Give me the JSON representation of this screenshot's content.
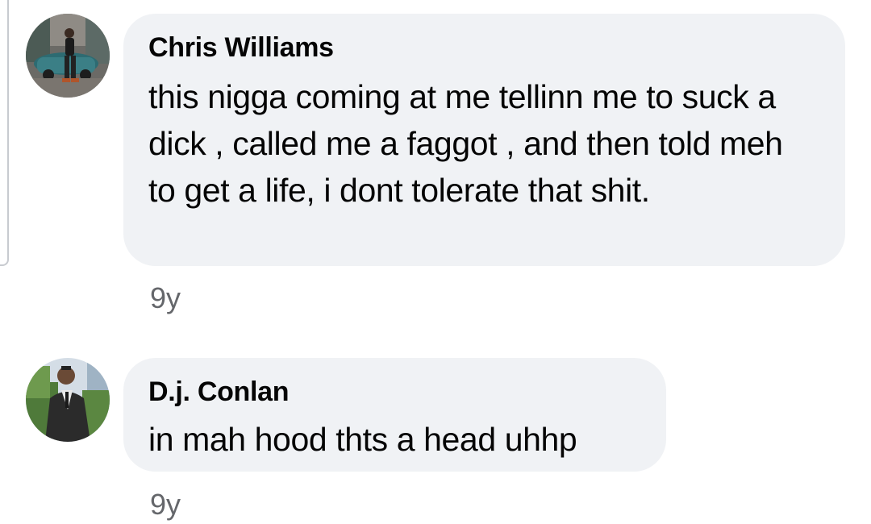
{
  "comments": [
    {
      "author": "Chris Williams",
      "text": "this nigga coming at me tellinn me to suck a dick , called me a faggot , and then told meh to get a life, i dont tolerate that shit.",
      "time": "9y",
      "avatar_icon": "profile-photo-man-with-car"
    },
    {
      "author": "D.j. Conlan",
      "text": "in mah hood thts a head uhhp",
      "time": "9y",
      "avatar_icon": "profile-photo-man-in-suit"
    }
  ],
  "colors": {
    "bubble_bg": "#f0f2f5",
    "text": "#050505",
    "meta_text": "#65676b",
    "thread_line": "#c8cbd0"
  }
}
